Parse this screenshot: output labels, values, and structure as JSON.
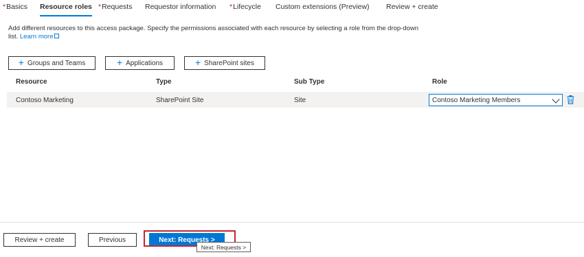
{
  "tabs": [
    {
      "label": "Basics",
      "required": true
    },
    {
      "label": "Resource roles",
      "required": false,
      "active": true
    },
    {
      "label": "Requests",
      "required": true
    },
    {
      "label": "Requestor information",
      "required": false
    },
    {
      "label": "Lifecycle",
      "required": true
    },
    {
      "label": "Custom extensions (Preview)",
      "required": false
    },
    {
      "label": "Review + create",
      "required": false
    }
  ],
  "required_marker": "*",
  "description": {
    "text": "Add different resources to this access package. Specify the permissions associated with each resource by selecting a role from the drop-down list.",
    "link": "Learn more"
  },
  "add_buttons": {
    "groups": "Groups and Teams",
    "applications": "Applications",
    "sharepoint": "SharePoint sites"
  },
  "table": {
    "headers": [
      "Resource",
      "Type",
      "Sub Type",
      "Role"
    ],
    "rows": [
      {
        "resource": "Contoso Marketing",
        "type": "SharePoint Site",
        "sub_type": "Site",
        "role": "Contoso Marketing Members"
      }
    ]
  },
  "footer": {
    "review_create": "Review + create",
    "previous": "Previous",
    "next": "Next: Requests >",
    "tooltip": "Next: Requests >"
  },
  "colors": {
    "accent": "#0078d4",
    "required": "#a4262c",
    "highlight": "#c4262e"
  }
}
